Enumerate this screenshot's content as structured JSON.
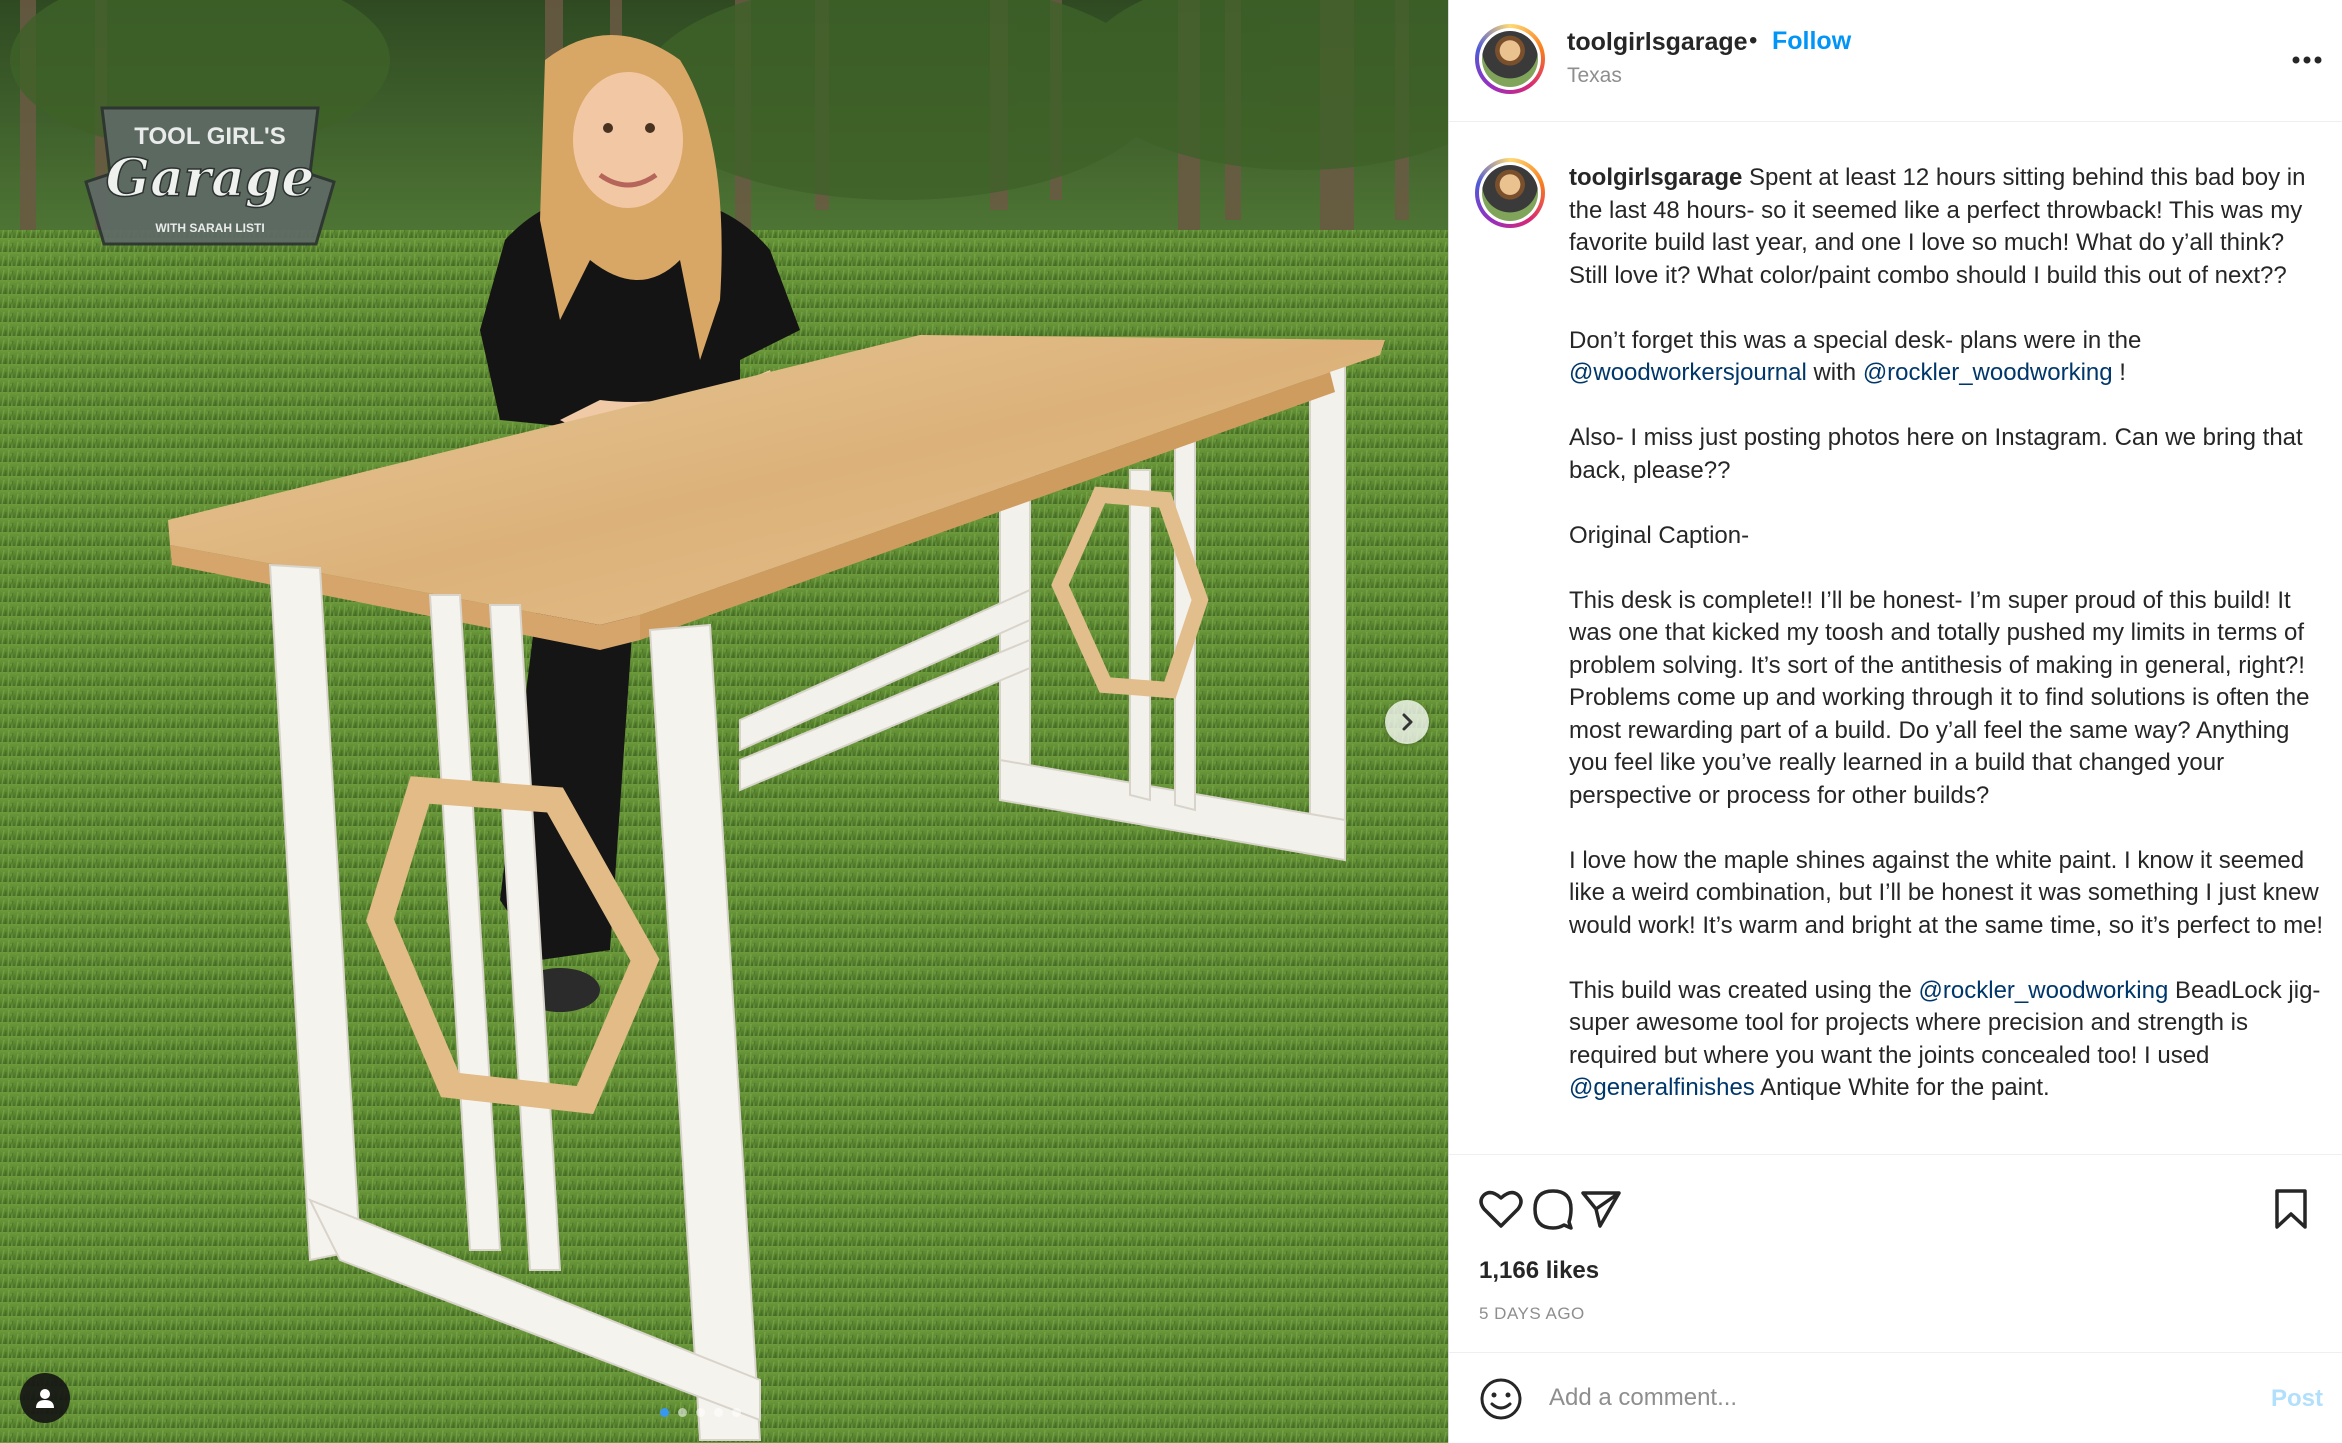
{
  "post": {
    "logo": {
      "line1": "TOOL GIRL'S",
      "line2": "Garage",
      "line3": "WITH SARAH LISTI"
    },
    "carousel": {
      "slide_count": 5,
      "active_index": 0
    },
    "icons": {
      "next": "chevron-right-icon",
      "tag": "user-tag-icon"
    }
  },
  "header": {
    "username": "toolgirlsgarage",
    "separator": "•",
    "follow_label": "Follow",
    "location": "Texas"
  },
  "caption": {
    "username": "toolgirlsgarage",
    "p1": "Spent at least 12 hours sitting behind this bad boy in the last 48 hours- so it seemed like a perfect throwback! This was my favorite build last year, and one I love so much! What do y’all think? Still love it? What color/paint combo should I build this out of next??",
    "p2_a": "Don’t forget this was a special desk- plans were in the ",
    "p2_mention1": "@woodworkersjournal",
    "p2_b": " with ",
    "p2_mention2": "@rockler_woodworking",
    "p2_c": " !",
    "p3": "Also- I miss just posting photos here on Instagram. Can we bring that back, please??",
    "p4": "Original Caption-",
    "p5": "This desk is complete!! I’ll be honest- I’m super proud of this build! It was one that kicked my toosh and totally pushed my limits in terms of problem solving. It’s sort of the antithesis of making in general, right?! Problems come up and working through it to find solutions is often the most rewarding part of a build. Do y’all feel the same way? Anything you feel like you’ve really learned in a build that changed your perspective or process for other builds?",
    "p6": "I love how the maple shines against the white paint. I know it seemed like a weird combination, but I’ll be honest it was something I just knew would work! It’s warm and bright at the same time, so it’s perfect to me!",
    "p7_a": "This build was created using the ",
    "p7_mention": "@rockler_woodworking",
    "p7_b": " BeadLock jig- super awesome tool for projects where precision and strength is required but where you want the joints concealed too! I used ",
    "p7_mention2": "@generalfinishes",
    "p7_c": " Antique White for the paint."
  },
  "actions": {
    "likes": "1,166 likes",
    "time_ago": "5 DAYS AGO",
    "icons": [
      "heart-icon",
      "comment-icon",
      "share-icon",
      "bookmark-icon"
    ]
  },
  "comment": {
    "placeholder": "Add a comment...",
    "post_label": "Post",
    "emoji_icon": "emoji-icon"
  },
  "colors": {
    "link": "#0095f6",
    "mention": "#00376b",
    "muted": "#8e8e8e",
    "post_disabled": "#b2dffc"
  }
}
